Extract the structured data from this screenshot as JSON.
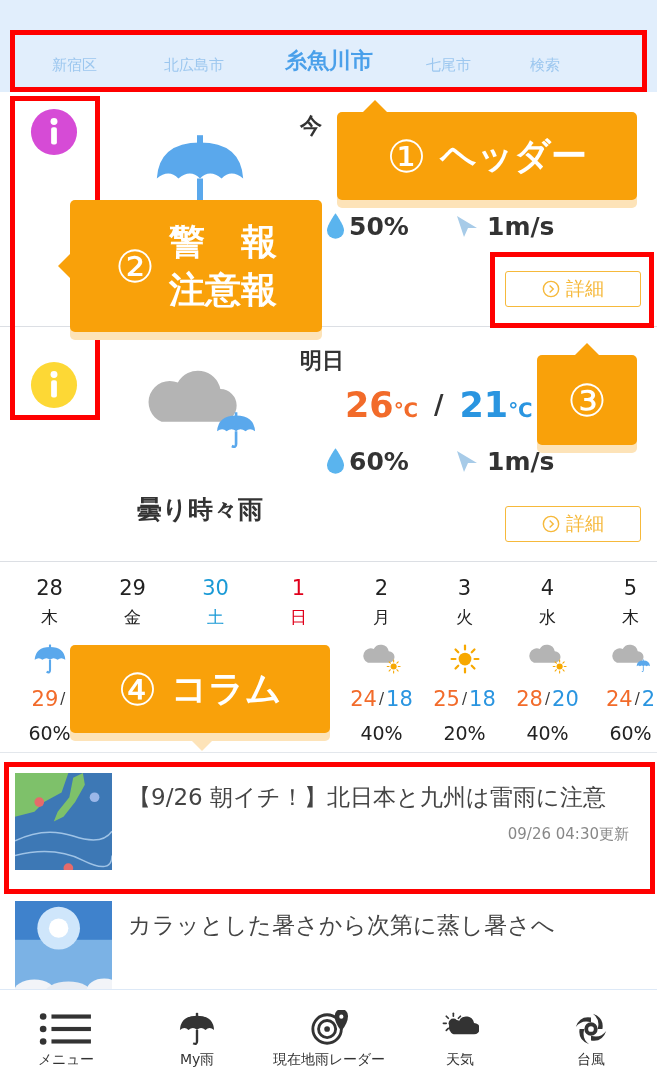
{
  "header": {
    "tabs": [
      {
        "label": "新宿区",
        "selected": false
      },
      {
        "label": "北広島市",
        "selected": false
      },
      {
        "label": "糸魚川市",
        "selected": true
      },
      {
        "label": "七尾市",
        "selected": false
      },
      {
        "label": "検索",
        "selected": false
      }
    ]
  },
  "forecasts": [
    {
      "alert": {
        "color": "#d64bd6"
      },
      "kind": "umbrella",
      "day_label": "今",
      "pop": "50%",
      "wind": "1m/s",
      "detail_button": "詳細"
    },
    {
      "alert": {
        "color": "#fdd835"
      },
      "kind": "cloud_umbrella",
      "condition": "曇り時々雨",
      "day_label": "明日",
      "high": {
        "value": "26",
        "unit": "℃"
      },
      "temp_separator": "/",
      "low": {
        "value": "21",
        "unit": "℃"
      },
      "pop": "60%",
      "wind": "1m/s",
      "detail_button": "詳細"
    }
  ],
  "daily": {
    "separator": "/",
    "days": [
      {
        "date": "28",
        "weekday": "木",
        "color": "#222222",
        "kind": "umbrella",
        "high": "29",
        "pop": "60%"
      },
      {
        "date": "29",
        "weekday": "金",
        "color": "#222222"
      },
      {
        "date": "30",
        "weekday": "土",
        "color": "#1a9ad6"
      },
      {
        "date": "1",
        "weekday": "日",
        "color": "#e0001b"
      },
      {
        "date": "2",
        "weekday": "月",
        "color": "#222222",
        "kind": "cloud_sun",
        "high": "24",
        "low": "18",
        "pop": "40%"
      },
      {
        "date": "3",
        "weekday": "火",
        "color": "#222222",
        "kind": "sun",
        "high": "25",
        "low": "18",
        "pop": "20%"
      },
      {
        "date": "4",
        "weekday": "水",
        "color": "#222222",
        "kind": "cloud_sun",
        "high": "28",
        "low": "20",
        "pop": "40%"
      },
      {
        "date": "5",
        "weekday": "木",
        "color": "#222222",
        "kind": "cloud_umbrella",
        "high": "24",
        "low": "2",
        "pop": "60%"
      }
    ]
  },
  "articles": [
    {
      "title": "【9/26 朝イチ！】北日本と九州は雷雨に注意",
      "updated": "09/26 04:30更新"
    },
    {
      "title": "カラッとした暑さから次第に蒸し暑さへ"
    }
  ],
  "bottom_nav": [
    {
      "kind": "menu",
      "label": "メニュー"
    },
    {
      "kind": "umbrella",
      "label": "My雨"
    },
    {
      "kind": "radar",
      "label": "現在地雨レーダー"
    },
    {
      "kind": "weather",
      "label": "天気"
    },
    {
      "kind": "typhoon",
      "label": "台風"
    }
  ],
  "annotations": [
    {
      "number": "①",
      "lines": [
        "ヘッダー"
      ]
    },
    {
      "number": "②",
      "lines": [
        "警　報",
        "注意報"
      ]
    },
    {
      "number": "③"
    },
    {
      "number": "④",
      "lines": [
        "コラム"
      ]
    }
  ]
}
